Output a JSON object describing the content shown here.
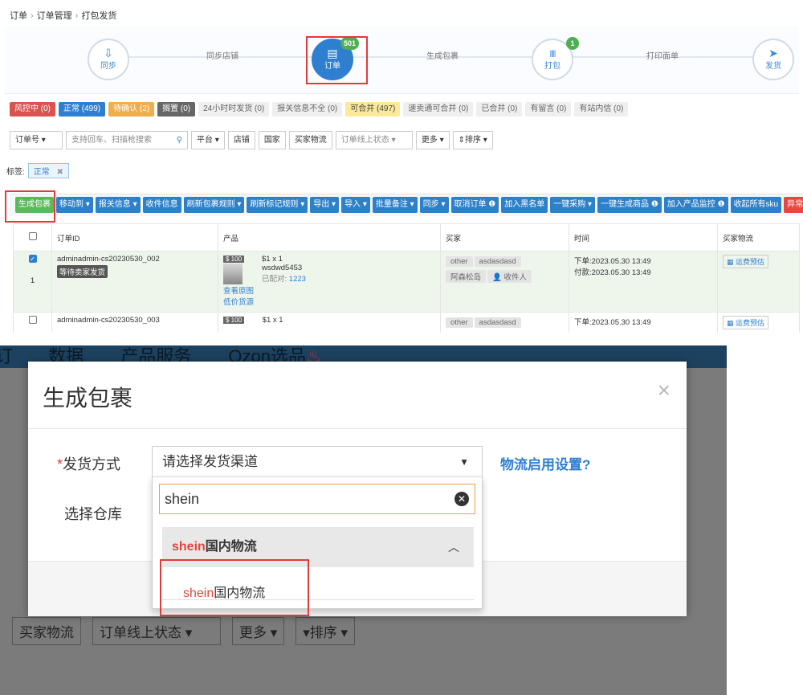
{
  "breadcrumb": {
    "items": [
      "订单",
      "订单管理",
      "打包发货"
    ],
    "separator": "›"
  },
  "steps": [
    {
      "label": "同步",
      "icon": "download-icon",
      "glyph": "⇩"
    },
    {
      "label": "订单",
      "icon": "order-icon",
      "glyph": "▤",
      "badge": "501",
      "active": true
    },
    {
      "label": "打包",
      "icon": "barcode-icon",
      "glyph": "|||||",
      "badge": "1"
    },
    {
      "label": "发货",
      "icon": "send-icon",
      "glyph": "➤"
    }
  ],
  "step_links": [
    "同步店铺",
    "生成包裹",
    "打印面单"
  ],
  "status_tabs": [
    {
      "label": "风控中 (0)",
      "color": "#d9534f"
    },
    {
      "label": "正常 (499)",
      "color": "#2f7fd0"
    },
    {
      "label": "待确认 (2)",
      "color": "#f0ad4e"
    },
    {
      "label": "搁置 (0)",
      "color": "#666666"
    },
    {
      "label": "24小时时发货 (0)",
      "style": "gray"
    },
    {
      "label": "报关信息不全 (0)",
      "style": "gray"
    },
    {
      "label": "可合并 (497)",
      "style": "yellow"
    },
    {
      "label": "速卖通可合并 (0)",
      "style": "gray"
    },
    {
      "label": "已合并 (0)",
      "style": "gray"
    },
    {
      "label": "有留言 (0)",
      "style": "gray"
    },
    {
      "label": "有站内信 (0)",
      "style": "gray"
    }
  ],
  "filters": {
    "order_no": "订单号",
    "search_placeholder": "支持回车、扫描枪搜索",
    "platform": "平台",
    "store": "店铺",
    "country": "国家",
    "buyer_logistics": "买家物流",
    "online_status": "订单线上状态",
    "more": "更多",
    "sort": "排序"
  },
  "tag": {
    "label": "标签:",
    "value": "正常",
    "remove": "✖"
  },
  "actions": [
    {
      "label": "生成包裹",
      "style": "green"
    },
    {
      "label": "移动到 ▾"
    },
    {
      "label": "报关信息 ▾"
    },
    {
      "label": "收件信息"
    },
    {
      "label": "刷新包裹规则 ▾"
    },
    {
      "label": "刷新标记规则 ▾"
    },
    {
      "label": "导出 ▾"
    },
    {
      "label": "导入 ▾"
    },
    {
      "label": "批量备注 ▾"
    },
    {
      "label": "同步 ▾"
    },
    {
      "label": "取消订单 ❶"
    },
    {
      "label": "加入黑名单"
    },
    {
      "label": "一键采购 ▾"
    },
    {
      "label": "一键生成商品 ❶"
    },
    {
      "label": "加入产品监控 ❶"
    },
    {
      "label": "收起所有sku"
    },
    {
      "label": "异常标",
      "style": "red"
    }
  ],
  "table": {
    "headers": [
      "订单ID",
      "产品",
      "买家",
      "时间",
      "买家物流"
    ],
    "rows": [
      {
        "index": "1",
        "order_id": "adminadmin-cs20230530_002",
        "status": "等待卖家发货",
        "price_tag": "$ 100",
        "qty": "$1 x 1",
        "sku": "wsdwd5453",
        "paired_label": "已配对:",
        "paired": "1223",
        "view_link": "查看原图",
        "low_price": "低价货源",
        "buyer_tags": [
          "other",
          "asdasdasd",
          "阿森松岛",
          "收件人"
        ],
        "order_time": "下单:2023.05.30 13:49",
        "pay_time": "付款:2023.05.30 13:49",
        "ship_btn": "运费预估"
      },
      {
        "order_id": "adminadmin-cs20230530_003",
        "price_tag": "$ 100",
        "qty": "$1 x 1",
        "buyer_tags": [
          "other",
          "asdasdasd"
        ],
        "order_time": "下单:2023.05.30 13:49",
        "ship_btn": "运费预估"
      }
    ]
  },
  "background_nav": {
    "items": [
      "订",
      "数据",
      "产品服务",
      "Ozon选品"
    ]
  },
  "background_buttons": [
    "买家物流",
    "订单线上状态 ▾",
    "更多 ▾",
    "▾排序 ▾"
  ],
  "modal": {
    "title": "生成包裹",
    "close": "×",
    "ship_method_label": "发货方式",
    "required_mark": "*",
    "select_placeholder": "请选择发货渠道",
    "logistics_settings_link": "物流启用设置?",
    "warehouse_label": "选择仓库",
    "search_value": "shein",
    "group": {
      "highlight": "shein",
      "rest": "国内物流"
    },
    "option": {
      "highlight": "shein",
      "rest": "国内物流"
    }
  }
}
